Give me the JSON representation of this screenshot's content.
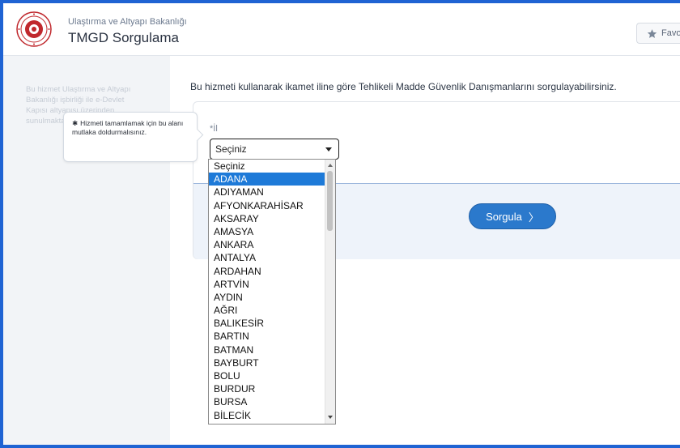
{
  "header": {
    "ministry": "Ulaştırma ve Altyapı Bakanlığı",
    "title": "TMGD Sorgulama",
    "favorites_label": "Favo"
  },
  "sidebar": {
    "text": "Bu hizmet Ulaştırma ve Altyapı Bakanlığı işbirliği ile e-Devlet Kapısı altyapısı üzerinden sunulmaktadır."
  },
  "main": {
    "description": "Bu hizmeti kullanarak ikamet iline göre Tehlikeli Madde Güvenlik Danışmanlarını sorgulayabilirsiniz.",
    "field_label": "*İl",
    "select_value": "Seçiniz",
    "submit_label": "Sorgula",
    "submit_chevron": "〉"
  },
  "tooltip": {
    "star": "✱",
    "text": "Hizmeti tamamlamak için bu alanı mutlaka doldurmalısınız."
  },
  "dropdown": {
    "selected_index": 1,
    "options": [
      "Seçiniz",
      "ADANA",
      "ADIYAMAN",
      "AFYONKARAHİSAR",
      "AKSARAY",
      "AMASYA",
      "ANKARA",
      "ANTALYA",
      "ARDAHAN",
      "ARTVİN",
      "AYDIN",
      "AĞRI",
      "BALIKESİR",
      "BARTIN",
      "BATMAN",
      "BAYBURT",
      "BOLU",
      "BURDUR",
      "BURSA",
      "BİLECİK"
    ]
  },
  "colors": {
    "accent": "#2b79cc",
    "selected": "#1e7ad8",
    "frame": "#1f63d3",
    "logo_red": "#c0282d"
  }
}
